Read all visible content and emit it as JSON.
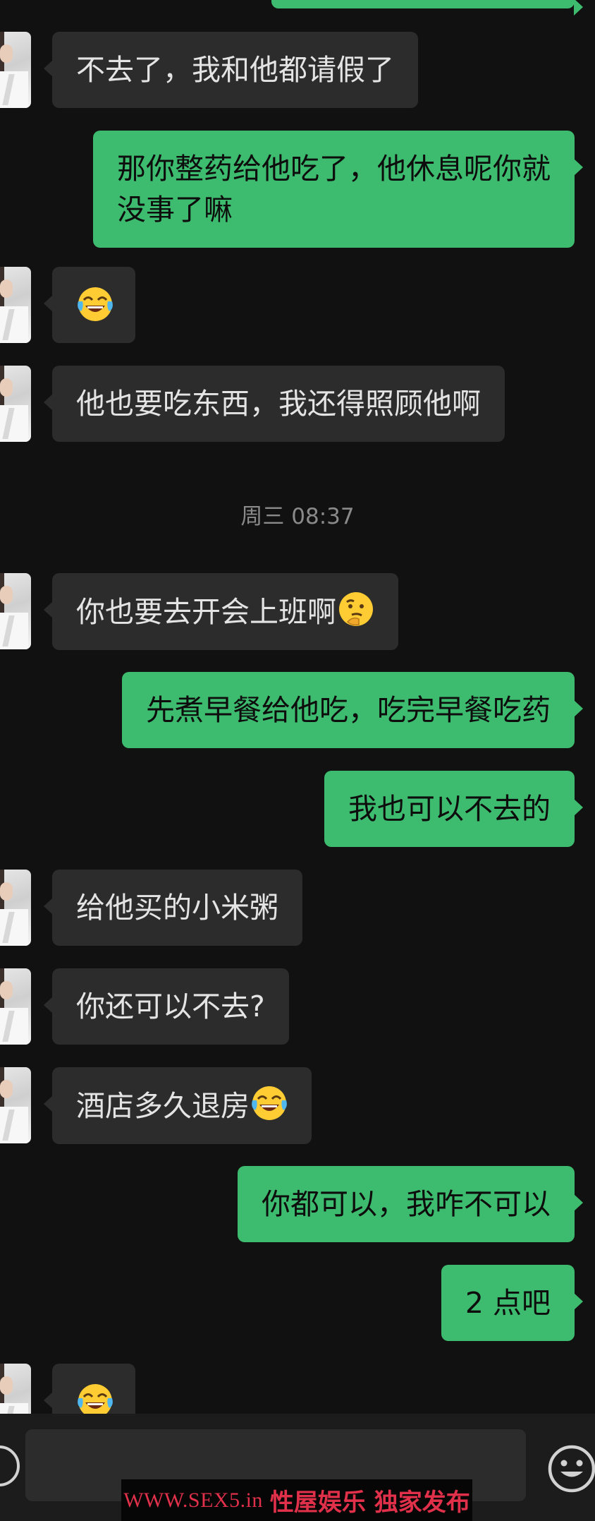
{
  "messages": [
    {
      "side": "out",
      "text": "",
      "partial": true
    },
    {
      "side": "in",
      "text": "不去了，我和他都请假了"
    },
    {
      "side": "out",
      "text": "那你整药给他吃了，他休息呢你就\n没事了嘛"
    },
    {
      "side": "in",
      "text": "",
      "emoji": "tears-of-joy-emoji"
    },
    {
      "side": "in",
      "text": "他也要吃东西，我还得照顾他啊"
    },
    {
      "side": "in",
      "text": "你也要去开会上班啊",
      "emoji": "thinking-face-emoji"
    },
    {
      "side": "out",
      "text": "先煮早餐给他吃，吃完早餐吃药"
    },
    {
      "side": "out",
      "text": "我也可以不去的"
    },
    {
      "side": "in",
      "text": "给他买的小米粥"
    },
    {
      "side": "in",
      "text": "你还可以不去?"
    },
    {
      "side": "in",
      "text": "酒店多久退房",
      "emoji": "tears-of-joy-emoji"
    },
    {
      "side": "out",
      "text": "你都可以，我咋不可以"
    },
    {
      "side": "out",
      "text": "2 点吧"
    },
    {
      "side": "in",
      "text": "",
      "emoji": "tears-of-joy-emoji",
      "partial": true
    }
  ],
  "timestamp": "周三 08:37",
  "input_bar": {
    "voice_icon": "voice-icon",
    "emoji_icon": "smile-icon",
    "input_value": ""
  },
  "watermark": {
    "url": "WWW.SEX5.in",
    "text": "性屋娱乐 独家发布"
  },
  "colors": {
    "background": "#111111",
    "incoming_bubble": "#2c2c2c",
    "outgoing_bubble": "#3dbb6e",
    "timestamp": "#8a8a8a",
    "watermark": "#e0304a"
  }
}
